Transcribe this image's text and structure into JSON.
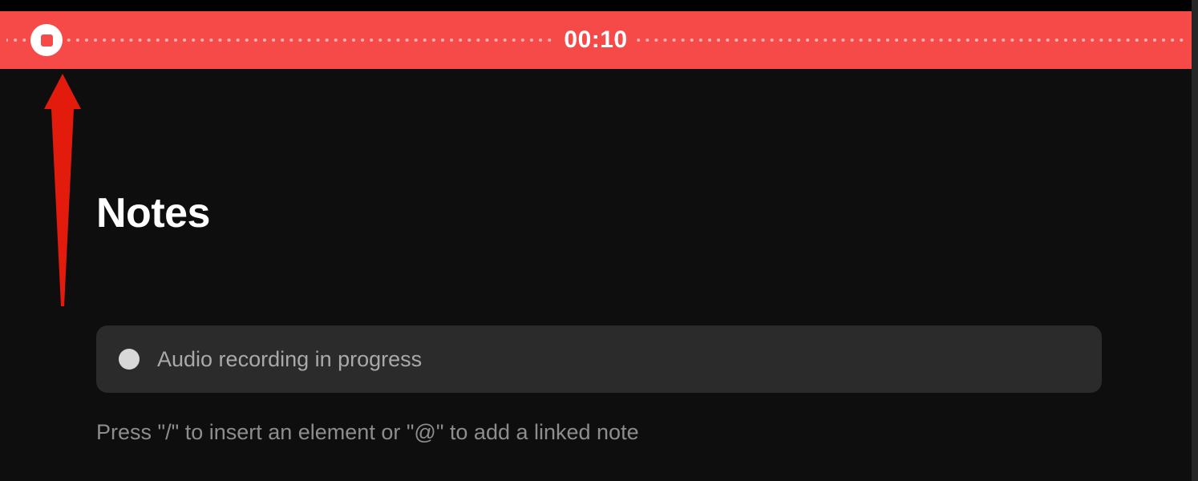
{
  "recording_bar": {
    "elapsed_time": "00:10",
    "stop_icon": "stop"
  },
  "page": {
    "title": "Notes"
  },
  "recording_card": {
    "status_label": "Audio recording in progress"
  },
  "editor_hint": "Press \"/\" to insert an element or \"@\" to add a linked note",
  "annotation": {
    "arrow_color": "#e31b0c"
  },
  "colors": {
    "recording_red": "#f64a49",
    "background": "#0e0e0e",
    "card": "#2b2b2b"
  }
}
